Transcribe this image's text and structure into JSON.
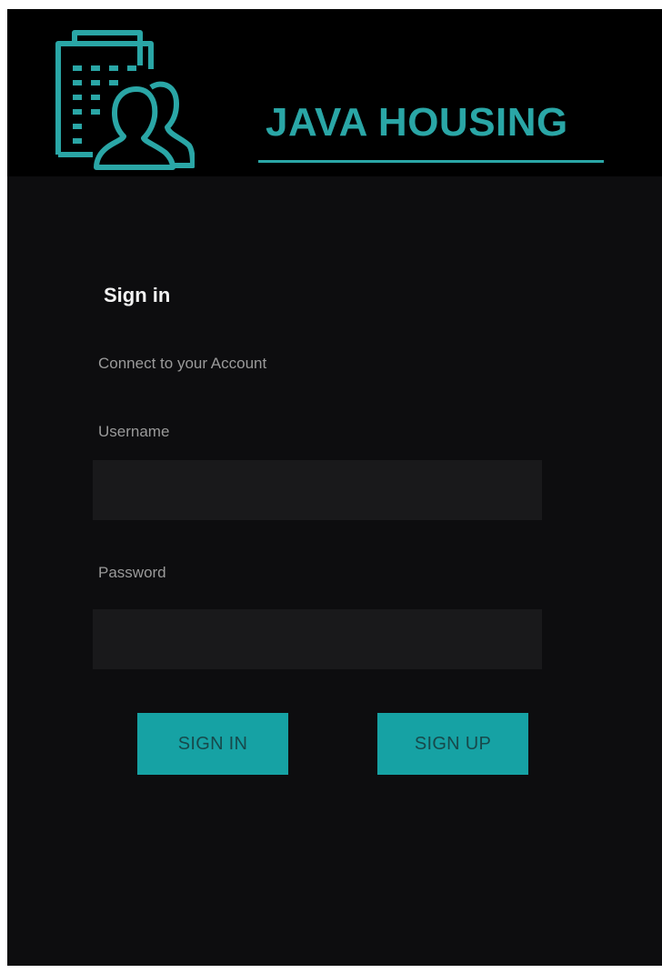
{
  "header": {
    "app_title": "JAVA HOUSING",
    "logo_icon": "building-people-icon",
    "accent_color": "#2aa6a6"
  },
  "form": {
    "heading": "Sign in",
    "subtitle": "Connect to your Account",
    "username_label": "Username",
    "username_value": "",
    "password_label": "Password",
    "password_value": ""
  },
  "actions": {
    "sign_in_label": "SIGN IN",
    "sign_up_label": "SIGN UP",
    "button_color": "#16a2a4"
  }
}
